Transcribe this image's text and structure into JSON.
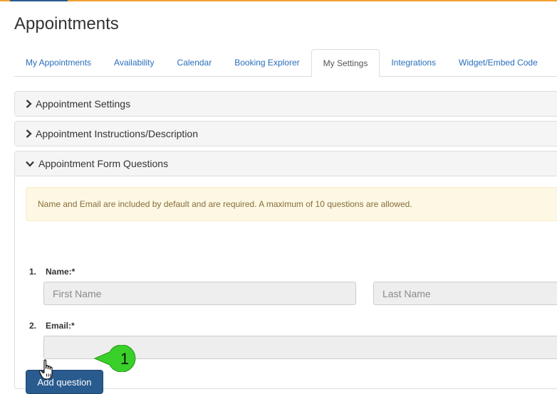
{
  "page": {
    "title": "Appointments"
  },
  "tabs": [
    {
      "label": "My Appointments",
      "active": false
    },
    {
      "label": "Availability",
      "active": false
    },
    {
      "label": "Calendar",
      "active": false
    },
    {
      "label": "Booking Explorer",
      "active": false
    },
    {
      "label": "My Settings",
      "active": true
    },
    {
      "label": "Integrations",
      "active": false
    },
    {
      "label": "Widget/Embed Code",
      "active": false
    }
  ],
  "panels": {
    "appointment_settings": {
      "title": "Appointment Settings",
      "expanded": false
    },
    "instructions": {
      "title": "Appointment Instructions/Description",
      "expanded": false
    },
    "form_questions": {
      "title": "Appointment Form Questions",
      "expanded": true,
      "alert": "Name and Email are included by default and are required. A maximum of 10 questions are allowed.",
      "questions": [
        {
          "number": "1.",
          "label": "Name:*",
          "first_placeholder": "First Name",
          "last_placeholder": "Last Name"
        },
        {
          "number": "2.",
          "label": "Email:*",
          "placeholder": ""
        }
      ],
      "add_button": "Add question"
    }
  },
  "annotation": {
    "step_number": "1",
    "color": "#39d129"
  },
  "colors": {
    "accent": "#2a6ebb",
    "button": "#295b8e",
    "alert_bg": "#fcf8e3",
    "alert_text": "#8a6d3b"
  }
}
